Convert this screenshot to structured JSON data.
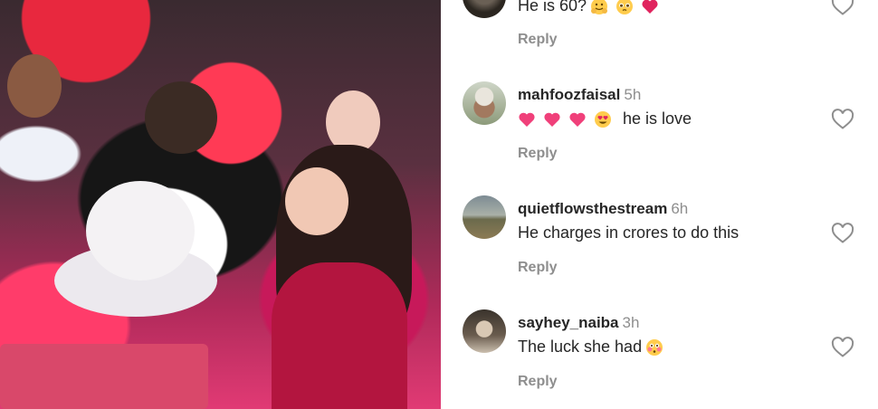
{
  "comments": [
    {
      "username": "",
      "time": "",
      "text": "He is 60?",
      "emojis": [
        "hugging-face",
        "pleading-face",
        "red-heart"
      ],
      "reply_label": "Reply"
    },
    {
      "username": "mahfoozfaisal",
      "time": "5h",
      "text": "he is love",
      "emojis_before": [
        "pink-heart",
        "pink-heart",
        "pink-heart",
        "heart-eyes"
      ],
      "reply_label": "Reply"
    },
    {
      "username": "quietflowsthestream",
      "time": "6h",
      "text": "He charges in crores to do this",
      "reply_label": "Reply"
    },
    {
      "username": "sayhey_naiba",
      "time": "3h",
      "text": "The luck she had",
      "emojis_after": [
        "flushed-face"
      ],
      "reply_label": "Reply"
    }
  ],
  "colors": {
    "text": "#262626",
    "muted": "#8e8e8e",
    "heart_outline": "#8e8e8e"
  }
}
